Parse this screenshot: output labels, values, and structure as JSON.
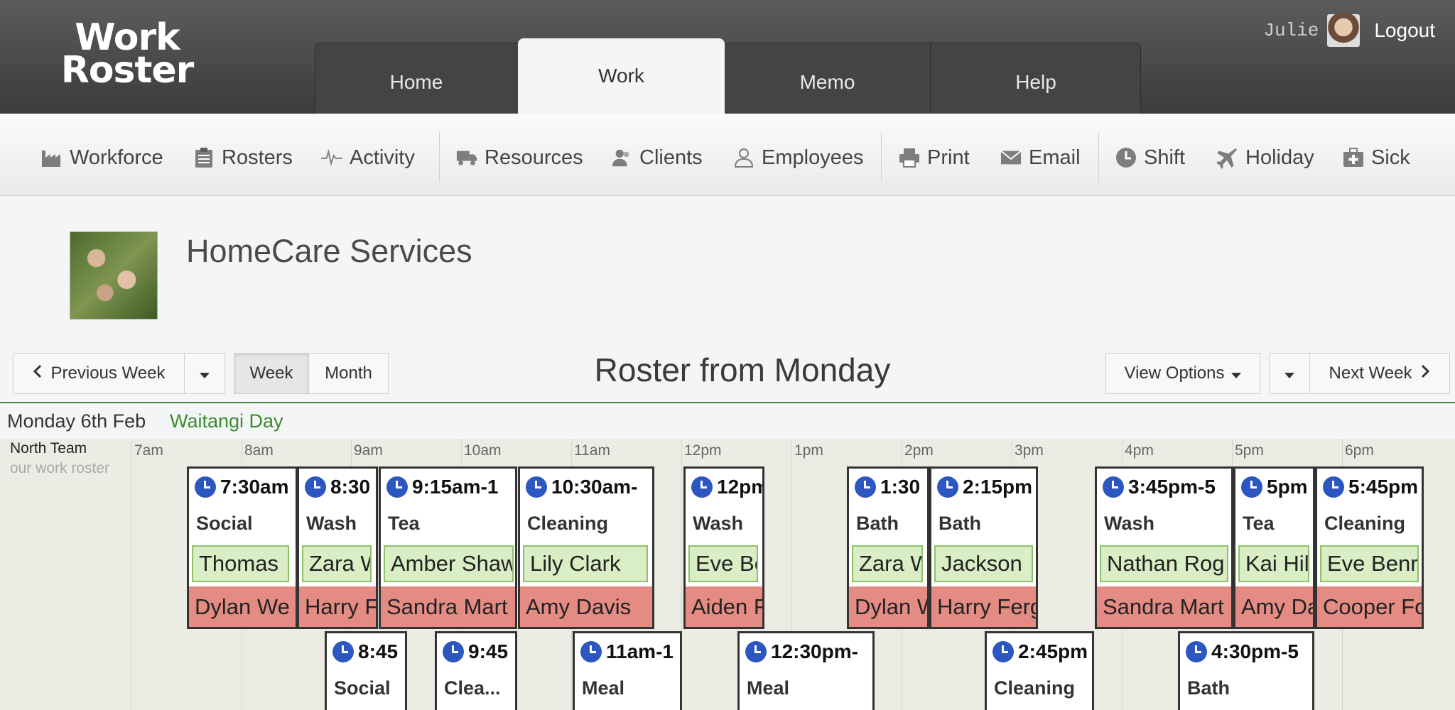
{
  "app": {
    "logo_line1": "Work",
    "logo_line2": "Roster",
    "user": "Julie",
    "logout": "Logout"
  },
  "main_tabs": [
    "Home",
    "Work",
    "Memo",
    "Help"
  ],
  "active_tab": "Work",
  "toolbar": {
    "workforce": "Workforce",
    "rosters": "Rosters",
    "activity": "Activity",
    "resources": "Resources",
    "clients": "Clients",
    "employees": "Employees",
    "print": "Print",
    "email": "Email",
    "shift": "Shift",
    "holiday": "Holiday",
    "sick": "Sick"
  },
  "org": {
    "name": "HomeCare Services"
  },
  "nav": {
    "prev": "Previous Week",
    "week": "Week",
    "month": "Month",
    "title": "Roster from Monday",
    "view_options": "View Options",
    "next": "Next Week"
  },
  "day": {
    "label": "Monday 6th Feb",
    "holiday": "Waitangi Day"
  },
  "team": {
    "name": "North Team",
    "subtitle": "our work roster"
  },
  "hours": [
    "7am",
    "8am",
    "9am",
    "10am",
    "11am",
    "12pm",
    "1pm",
    "2pm",
    "3pm",
    "4pm",
    "5pm",
    "6pm"
  ],
  "shifts_row1": [
    {
      "time": "7:30am",
      "task": "Social",
      "client": "Thomas",
      "staff": "Dylan We"
    },
    {
      "time": "8:30",
      "task": "Wash",
      "client": "Zara W",
      "staff": "Harry F"
    },
    {
      "time": "9:15am-1",
      "task": "Tea",
      "client": "Amber Shaw",
      "staff": "Sandra Mart"
    },
    {
      "time": "10:30am-",
      "task": "Cleaning",
      "client": "Lily Clark",
      "staff": "Amy Davis"
    },
    {
      "time": "12pm",
      "task": "Wash",
      "client": "Eve Be",
      "staff": "Aiden F"
    },
    {
      "time": "1:30",
      "task": "Bath",
      "client": "Zara W",
      "staff": "Dylan W"
    },
    {
      "time": "2:15pm",
      "task": "Bath",
      "client": "Jackson",
      "staff": "Harry Ferg"
    },
    {
      "time": "3:45pm-5",
      "task": "Wash",
      "client": "Nathan Rog",
      "staff": "Sandra Mart"
    },
    {
      "time": "5pm",
      "task": "Tea",
      "client": "Kai Hil",
      "staff": "Amy Da"
    },
    {
      "time": "5:45pm",
      "task": "Cleaning",
      "client": "Eve Benr",
      "staff": "Cooper Fo"
    }
  ],
  "shifts_row2": [
    {
      "time": "8:45",
      "task": "Social"
    },
    {
      "time": "9:45",
      "task": "Clea..."
    },
    {
      "time": "11am-1",
      "task": "Meal"
    },
    {
      "time": "12:30pm-",
      "task": "Meal"
    },
    {
      "time": "2:45pm",
      "task": "Cleaning"
    },
    {
      "time": "4:30pm-5",
      "task": "Bath"
    }
  ]
}
